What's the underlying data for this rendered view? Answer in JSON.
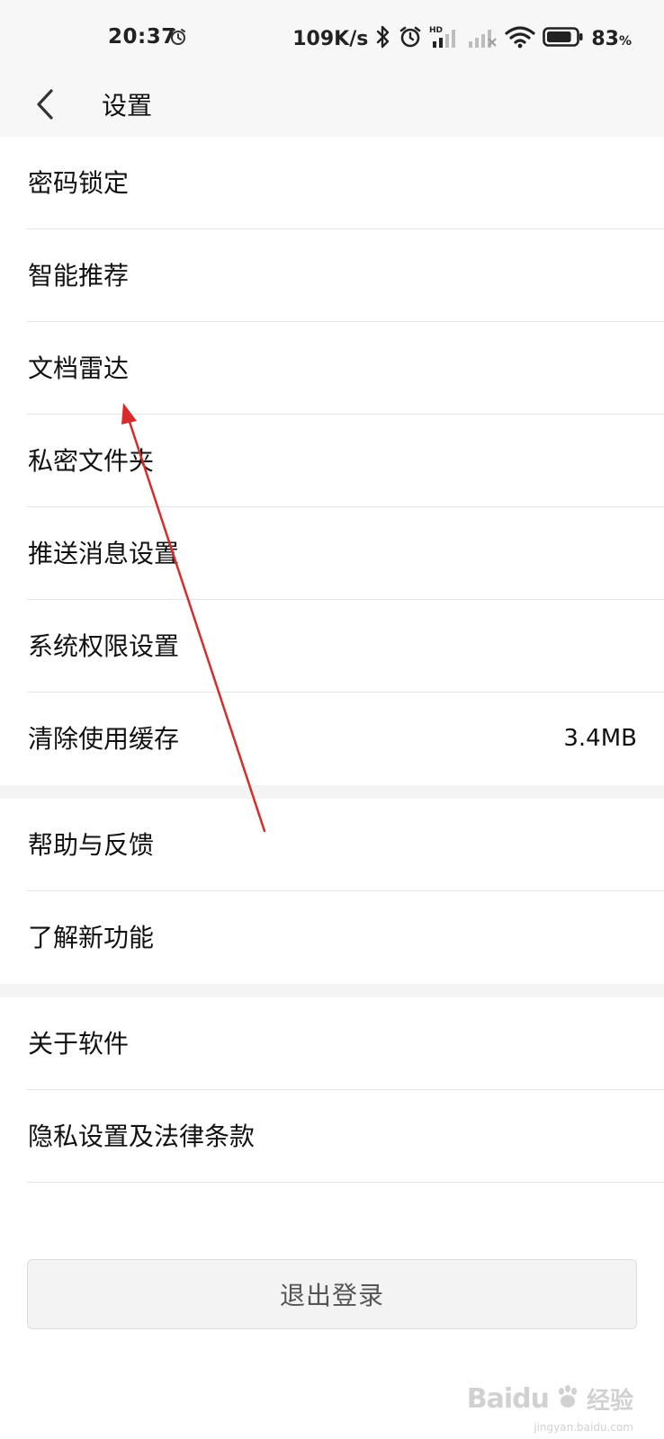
{
  "status_bar": {
    "time": "20:37",
    "network_speed": "109K/s",
    "battery_percent": "83",
    "battery_unit": "%",
    "battery_level": 0.83
  },
  "header": {
    "title": "设置",
    "back_icon": "chevron-left-icon"
  },
  "sections": [
    {
      "items": [
        {
          "label": "密码锁定"
        },
        {
          "label": "智能推荐"
        },
        {
          "label": "文档雷达"
        },
        {
          "label": "私密文件夹"
        },
        {
          "label": "推送消息设置"
        },
        {
          "label": "系统权限设置"
        },
        {
          "label": "清除使用缓存",
          "value": "3.4MB"
        }
      ]
    },
    {
      "items": [
        {
          "label": "帮助与反馈"
        },
        {
          "label": "了解新功能"
        }
      ]
    },
    {
      "items": [
        {
          "label": "关于软件"
        },
        {
          "label": "隐私设置及法律条款"
        }
      ]
    }
  ],
  "logout": {
    "label": "退出登录"
  },
  "watermark": {
    "brand": "Baidu",
    "text": "经验",
    "url": "jingyan.baidu.com"
  },
  "colors": {
    "annotation_arrow": "#d92b2b",
    "header_bg": "#f7f7f7",
    "gap_bg": "#f4f4f4"
  }
}
